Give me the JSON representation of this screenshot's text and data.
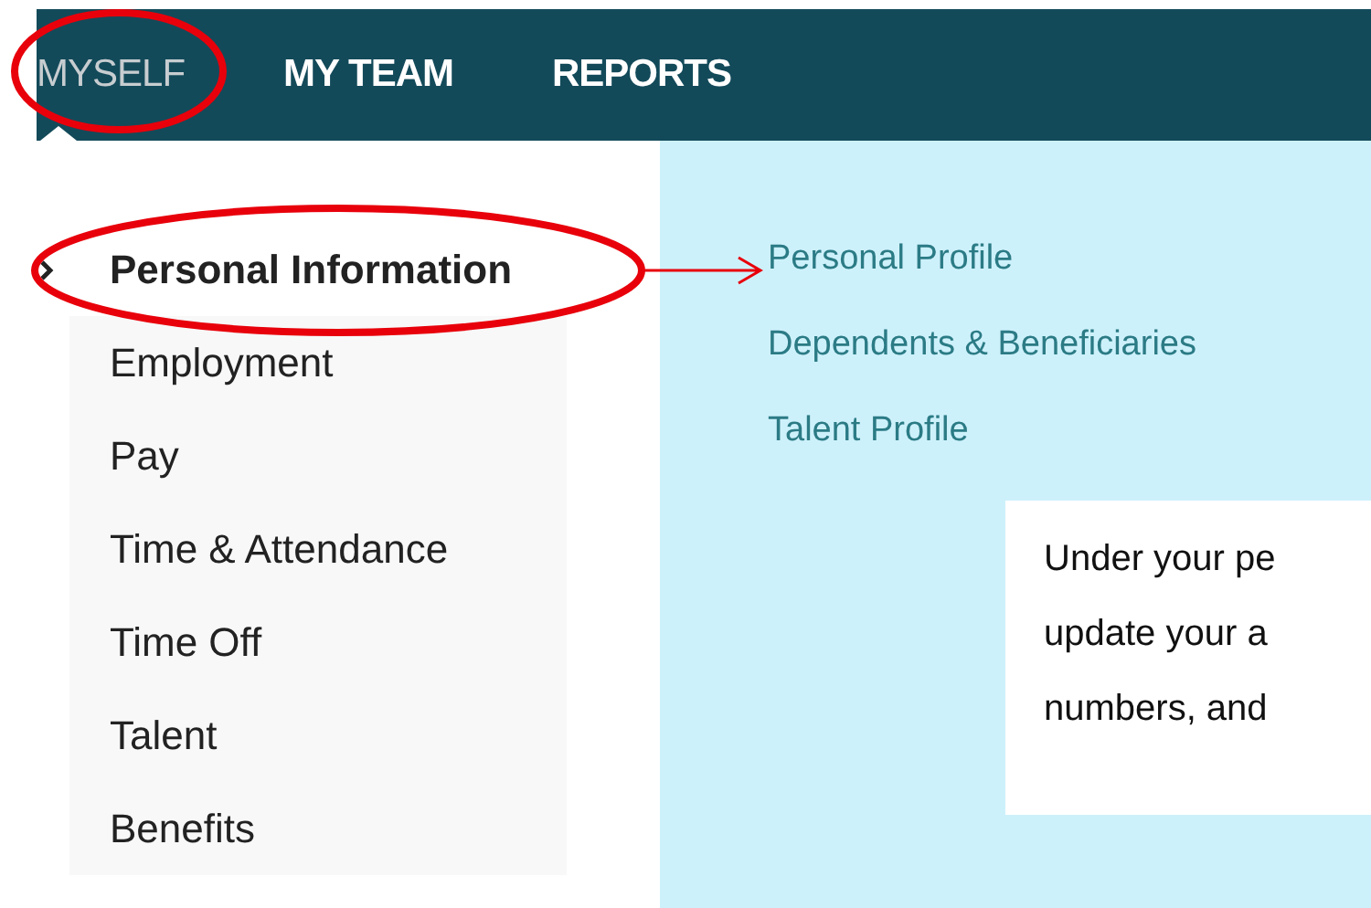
{
  "nav": {
    "tabs": [
      {
        "label": "MYSELF",
        "selected": true
      },
      {
        "label": "MY TEAM",
        "selected": false
      },
      {
        "label": "REPORTS",
        "selected": false
      }
    ]
  },
  "menu": {
    "items": [
      {
        "label": "Personal Information",
        "selected": true
      },
      {
        "label": "Employment",
        "selected": false
      },
      {
        "label": "Pay",
        "selected": false
      },
      {
        "label": "Time & Attendance",
        "selected": false
      },
      {
        "label": "Time Off",
        "selected": false
      },
      {
        "label": "Talent",
        "selected": false
      },
      {
        "label": "Benefits",
        "selected": false
      }
    ]
  },
  "submenu": {
    "links": [
      "Personal Profile",
      "Dependents & Beneficiaries",
      "Talent Profile"
    ]
  },
  "callout": {
    "lines": [
      "Under your pe",
      "update your a",
      "numbers, and"
    ]
  }
}
